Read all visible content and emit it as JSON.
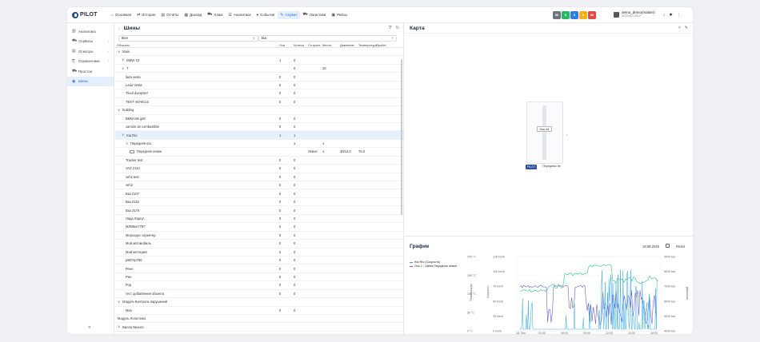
{
  "app": {
    "logo_text": "PILOT"
  },
  "nav": [
    {
      "icon": "⌂",
      "label": "Основная"
    },
    {
      "icon": "⇄",
      "label": "История"
    },
    {
      "icon": "▤",
      "label": "Отчёты"
    },
    {
      "icon": "▦",
      "label": "Доклад"
    },
    {
      "icon": "⛟",
      "label": "Хлам"
    },
    {
      "icon": "☰",
      "label": "Аналитика"
    },
    {
      "icon": "♦",
      "label": "События"
    },
    {
      "icon": "✎",
      "label": "Сервис"
    },
    {
      "icon": "⛟",
      "label": "Логистика"
    },
    {
      "icon": "▣",
      "label": "Рейсы"
    }
  ],
  "status_badges": [
    {
      "text": "88",
      "color": "#6c7480"
    },
    {
      "text": "8",
      "color": "#28b765"
    },
    {
      "text": "8",
      "color": "#2f7be5"
    },
    {
      "text": "8",
      "color": "#f2b01e"
    },
    {
      "text": "88",
      "color": "#e5483f"
    }
  ],
  "user": {
    "name": "demo_demo(master)",
    "sub": "9025441195-P"
  },
  "sidebar": {
    "items": [
      {
        "icon": "▥",
        "label": "Аналитика",
        "chevron": ""
      },
      {
        "icon": "⛟",
        "label": "Сервисы",
        "chevron": "›"
      },
      {
        "icon": "▤",
        "label": "Осмотры",
        "chevron": "›"
      },
      {
        "icon": "⎘",
        "label": "Справочники",
        "chevron": "›"
      },
      {
        "icon": "⛟",
        "label": "Простои",
        "chevron": ""
      },
      {
        "icon": "◉",
        "label": "Шины",
        "chevron": ""
      }
    ],
    "collapse": "«"
  },
  "panel": {
    "back": "‹",
    "title": "Шины",
    "filter_value": "Все",
    "search_value": "kia",
    "columns": [
      "Объекты",
      "Оси",
      "Колеса",
      "Сторона",
      "Место",
      "Давление",
      "Температура",
      "Пробег"
    ],
    "rows": [
      {
        "d": 0,
        "t": "∨",
        "name": "Main",
        "c": [
          "",
          "",
          "",
          "",
          "",
          "",
          ""
        ]
      },
      {
        "d": 1,
        "t": "∨",
        "name": "BMW X3",
        "c": [
          "1",
          "0",
          "",
          "",
          "",
          "",
          ""
        ]
      },
      {
        "d": 1,
        "t": "∨",
        "name": "T",
        "c": [
          "",
          "0",
          "",
          "10",
          "",
          "",
          ""
        ]
      },
      {
        "d": 2,
        "t": "",
        "name": "lada vesta",
        "c": [
          "0",
          "0",
          "",
          "",
          "",
          "",
          ""
        ]
      },
      {
        "d": 2,
        "t": "",
        "name": "Lada Vesta",
        "c": [
          "0",
          "0",
          "",
          "",
          "",
          "",
          ""
        ]
      },
      {
        "d": 2,
        "t": "",
        "name": "Tlexit dumpster",
        "c": [
          "0",
          "0",
          "",
          "",
          "",
          "",
          ""
        ]
      },
      {
        "d": 2,
        "t": "",
        "name": "TEST VEHICLE",
        "c": [
          "0",
          "0",
          "",
          "",
          "",
          "",
          ""
        ]
      },
      {
        "d": 0,
        "t": "∨",
        "name": "building",
        "c": [
          "",
          "",
          "",
          "",
          "",
          "",
          ""
        ]
      },
      {
        "d": 2,
        "t": "",
        "name": "BMW M5 g60",
        "c": [
          "0",
          "0",
          "",
          "",
          "",
          "",
          ""
        ]
      },
      {
        "d": 2,
        "t": "",
        "name": "camión de combustible",
        "c": [
          "0",
          "0",
          "",
          "",
          "",
          "",
          ""
        ]
      },
      {
        "d": 1,
        "t": "∨",
        "name": "Kia Rio",
        "c": [
          "1",
          "1",
          "",
          "",
          "",
          "",
          ""
        ],
        "sel": true
      },
      {
        "d": 2,
        "t": "∨",
        "name": "Передняя ось",
        "c": [
          "",
          "1",
          "",
          "1",
          "",
          "",
          ""
        ]
      },
      {
        "d": 3,
        "t": "",
        "name": "Передняя левое",
        "tire": true,
        "c": [
          "",
          "",
          "Левое",
          "1",
          "40/12.0",
          "75.0",
          ""
        ]
      },
      {
        "d": 2,
        "t": "",
        "name": "Tracker test",
        "c": [
          "0",
          "0",
          "",
          "",
          "",
          "",
          ""
        ]
      },
      {
        "d": 2,
        "t": "",
        "name": "VAZ 2110",
        "c": [
          "0",
          "0",
          "",
          "",
          "",
          "",
          ""
        ]
      },
      {
        "d": 2,
        "t": "",
        "name": "veh1 test",
        "c": [
          "0",
          "0",
          "",
          "",
          "",
          "",
          ""
        ]
      },
      {
        "d": 2,
        "t": "",
        "name": "veh2",
        "c": [
          "0",
          "0",
          "",
          "",
          "",
          "",
          ""
        ]
      },
      {
        "d": 2,
        "t": "",
        "name": "Ваз 2107",
        "c": [
          "0",
          "0",
          "",
          "",
          "",
          "",
          ""
        ]
      },
      {
        "d": 2,
        "t": "",
        "name": "Ваз 2115",
        "c": [
          "0",
          "0",
          "",
          "",
          "",
          "",
          ""
        ]
      },
      {
        "d": 2,
        "t": "",
        "name": "Ваз 2170",
        "c": [
          "0",
          "0",
          "",
          "",
          "",
          "",
          ""
        ]
      },
      {
        "d": 2,
        "t": "",
        "name": "Лада Ларгус",
        "c": [
          "0",
          "0",
          "",
          "",
          "",
          "",
          ""
        ]
      },
      {
        "d": 2,
        "t": "",
        "name": "МЛ0Век7787",
        "c": [
          "0",
          "0",
          "",
          "",
          "",
          "",
          ""
        ]
      },
      {
        "d": 2,
        "t": "",
        "name": "Мерседес спринтер",
        "c": [
          "0",
          "0",
          "",
          "",
          "",
          "",
          ""
        ]
      },
      {
        "d": 2,
        "t": "",
        "name": "Мой автомобиль",
        "c": [
          "0",
          "0",
          "",
          "",
          "",
          "",
          ""
        ]
      },
      {
        "d": 2,
        "t": "",
        "name": "Мой мотоцикл",
        "c": [
          "0",
          "0",
          "",
          "",
          "",
          "",
          ""
        ]
      },
      {
        "d": 2,
        "t": "",
        "name": "р887пр790",
        "c": [
          "0",
          "0",
          "",
          "",
          "",
          "",
          ""
        ]
      },
      {
        "d": 2,
        "t": "",
        "name": "Рено",
        "c": [
          "0",
          "0",
          "",
          "",
          "",
          "",
          ""
        ]
      },
      {
        "d": 2,
        "t": "",
        "name": "Рио",
        "c": [
          "0",
          "0",
          "",
          "",
          "",
          "",
          ""
        ]
      },
      {
        "d": 2,
        "t": "",
        "name": "Рор",
        "c": [
          "0",
          "0",
          "",
          "",
          "",
          "",
          ""
        ]
      },
      {
        "d": 2,
        "t": "",
        "name": "тест добавления объекта",
        "c": [
          "0",
          "0",
          "",
          "",
          "",
          "",
          ""
        ]
      },
      {
        "d": 0,
        "t": "∨",
        "name": "Модуль Контроль нарушений",
        "c": [
          "",
          "",
          "",
          "",
          "",
          "",
          ""
        ]
      },
      {
        "d": 2,
        "t": "",
        "name": "Man",
        "c": [
          "0",
          "0",
          "",
          "",
          "",
          "",
          ""
        ]
      },
      {
        "d": 0,
        "t": "",
        "name": "Модуль Логистика",
        "c": [
          "",
          "",
          "",
          "",
          "",
          "",
          ""
        ]
      },
      {
        "d": 0,
        "t": "∨",
        "name": "Вилла Бизнес",
        "c": [
          "",
          "",
          "",
          "",
          "",
          "",
          ""
        ]
      }
    ]
  },
  "map": {
    "title": "Карта",
    "axle_label": "Ось #1",
    "pilot_tag": "PILOT",
    "front_label": "Передняя ле",
    "dot": "•"
  },
  "graph": {
    "title": "График",
    "date": "18.09.2025",
    "reset": "Reset",
    "legend": [
      {
        "label": "Kia Rio (Скорость)",
        "color": "#2aa6e6"
      },
      {
        "label": "Ось 1 - Шина Передняя левое",
        "color": "#6b5fd3"
      }
    ],
    "axis_temp_label": "Температура",
    "axis_speed_label": "Скорость",
    "axis_pressure_label": "Давление",
    "temp_ticks": [
      "200 °C",
      "150 °C",
      "100 °C",
      "50 °C",
      "0 °C"
    ],
    "speed_ticks": [
      "125 km/h",
      "100 km/h",
      "75 km/h",
      "50 km/h",
      "25 km/h",
      "0 km/h"
    ],
    "pressure_ticks": [
      "9000 bar",
      "8000 bar",
      "7000 bar",
      "6000 bar",
      "5000 bar",
      "4000 bar"
    ],
    "x_ticks": [
      "18. Sep",
      "03:00",
      "06:00",
      "09:00",
      "12:00",
      "15:00",
      "18:00"
    ],
    "colors": {
      "speed": "#2aa6e6",
      "pressure": "#6b5fd3",
      "temp": "#3ccf8e"
    }
  }
}
